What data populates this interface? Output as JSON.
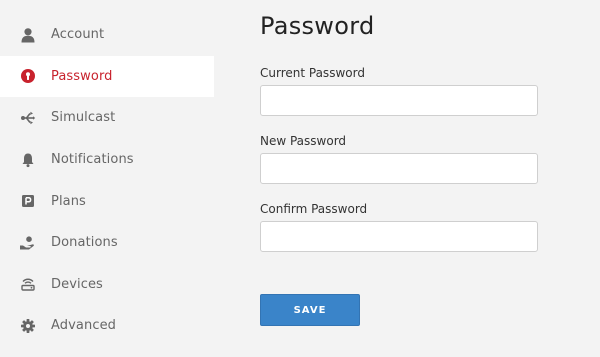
{
  "sidebar": {
    "items": [
      {
        "label": "Account",
        "icon": "user-icon",
        "active": false
      },
      {
        "label": "Password",
        "icon": "lock-icon",
        "active": true
      },
      {
        "label": "Simulcast",
        "icon": "simulcast-icon",
        "active": false
      },
      {
        "label": "Notifications",
        "icon": "bell-icon",
        "active": false
      },
      {
        "label": "Plans",
        "icon": "plans-icon",
        "active": false
      },
      {
        "label": "Donations",
        "icon": "donation-icon",
        "active": false
      },
      {
        "label": "Devices",
        "icon": "devices-icon",
        "active": false
      },
      {
        "label": "Advanced",
        "icon": "gear-icon",
        "active": false
      }
    ]
  },
  "main": {
    "title": "Password",
    "fields": [
      {
        "label": "Current Password",
        "value": "",
        "placeholder": ""
      },
      {
        "label": "New Password",
        "value": "",
        "placeholder": ""
      },
      {
        "label": "Confirm Password",
        "value": "",
        "placeholder": ""
      }
    ],
    "save_label": "SAVE"
  },
  "colors": {
    "background": "#f3f3f3",
    "active_item_background": "#ffffff",
    "active_accent": "#c8222d",
    "icon": "#666666",
    "button": "#3a84c9"
  }
}
